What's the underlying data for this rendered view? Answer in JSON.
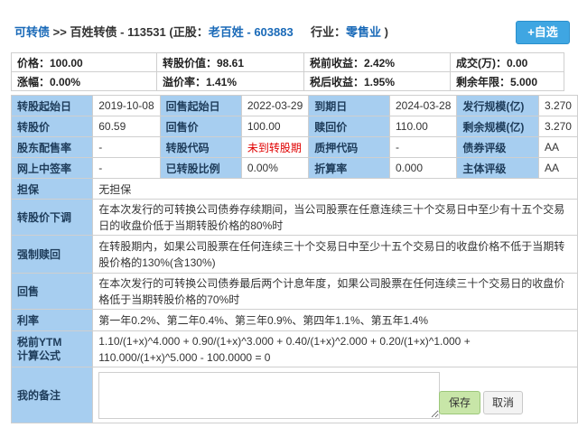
{
  "header": {
    "bond_type": "可转债",
    "separator": ">>",
    "bond_name": "百姓转债",
    "bond_code": "113531",
    "stock_prefix": "(正股：",
    "stock_name": "老百姓",
    "stock_dash": "-",
    "stock_code": "603883",
    "industry_label": "行业：",
    "industry": "零售业",
    "industry_suffix": ")",
    "add_button": "+自选"
  },
  "quote": [
    [
      "价格：100.00",
      "转股价值：98.61",
      "税前收益：2.42%",
      "成交(万)：0.00"
    ],
    [
      "涨幅：0.00%",
      "溢价率：1.41%",
      "税后收益：1.95%",
      "剩余年限：5.000"
    ]
  ],
  "info": {
    "rows": [
      [
        {
          "label": "转股起始日",
          "value": "2019-10-08"
        },
        {
          "label": "回售起始日",
          "value": "2022-03-29"
        },
        {
          "label": "到期日",
          "value": "2024-03-28"
        },
        {
          "label": "发行规模(亿)",
          "value": "3.270"
        }
      ],
      [
        {
          "label": "转股价",
          "value": "60.59"
        },
        {
          "label": "回售价",
          "value": "100.00"
        },
        {
          "label": "赎回价",
          "value": "110.00"
        },
        {
          "label": "剩余规模(亿)",
          "value": "3.270"
        }
      ],
      [
        {
          "label": "股东配售率",
          "value": "-"
        },
        {
          "label": "转股代码",
          "value": "未到转股期"
        },
        {
          "label": "质押代码",
          "value": "-"
        },
        {
          "label": "债券评级",
          "value": "AA"
        }
      ],
      [
        {
          "label": "网上中签率",
          "value": "-"
        },
        {
          "label": "已转股比例",
          "value": "0.00%"
        },
        {
          "label": "折算率",
          "value": "0.000"
        },
        {
          "label": "主体评级",
          "value": "AA"
        }
      ]
    ],
    "guarantee": {
      "label": "担保",
      "value": "无担保"
    },
    "downward_revision": {
      "label": "转股价下调",
      "value": "在本次发行的可转换公司债券存续期间，当公司股票在任意连续三十个交易日中至少有十五个交易日的收盘价低于当期转股价格的80%时"
    },
    "forced_redemption": {
      "label": "强制赎回",
      "value": "在转股期内，如果公司股票在任何连续三十个交易日中至少十五个交易日的收盘价格不低于当期转股价格的130%(含130%)"
    },
    "putback": {
      "label": "回售",
      "value": "在本次发行的可转换公司债券最后两个计息年度，如果公司股票在任何连续三十个交易日的收盘价格低于当期转股价格的70%时"
    },
    "interest_rate": {
      "label": "利率",
      "value": "第一年0.2%、第二年0.4%、第三年0.9%、第四年1.1%、第五年1.4%"
    },
    "ytm_formula": {
      "label_line1": "税前YTM",
      "label_line2": "计算公式",
      "value": "1.10/(1+x)^4.000 + 0.90/(1+x)^3.000 + 0.40/(1+x)^2.000 + 0.20/(1+x)^1.000 + 110.000/(1+x)^5.000 - 100.0000 = 0"
    },
    "remark": {
      "label": "我的备注",
      "value": ""
    }
  },
  "buttons": {
    "save": "保存",
    "cancel": "取消"
  }
}
